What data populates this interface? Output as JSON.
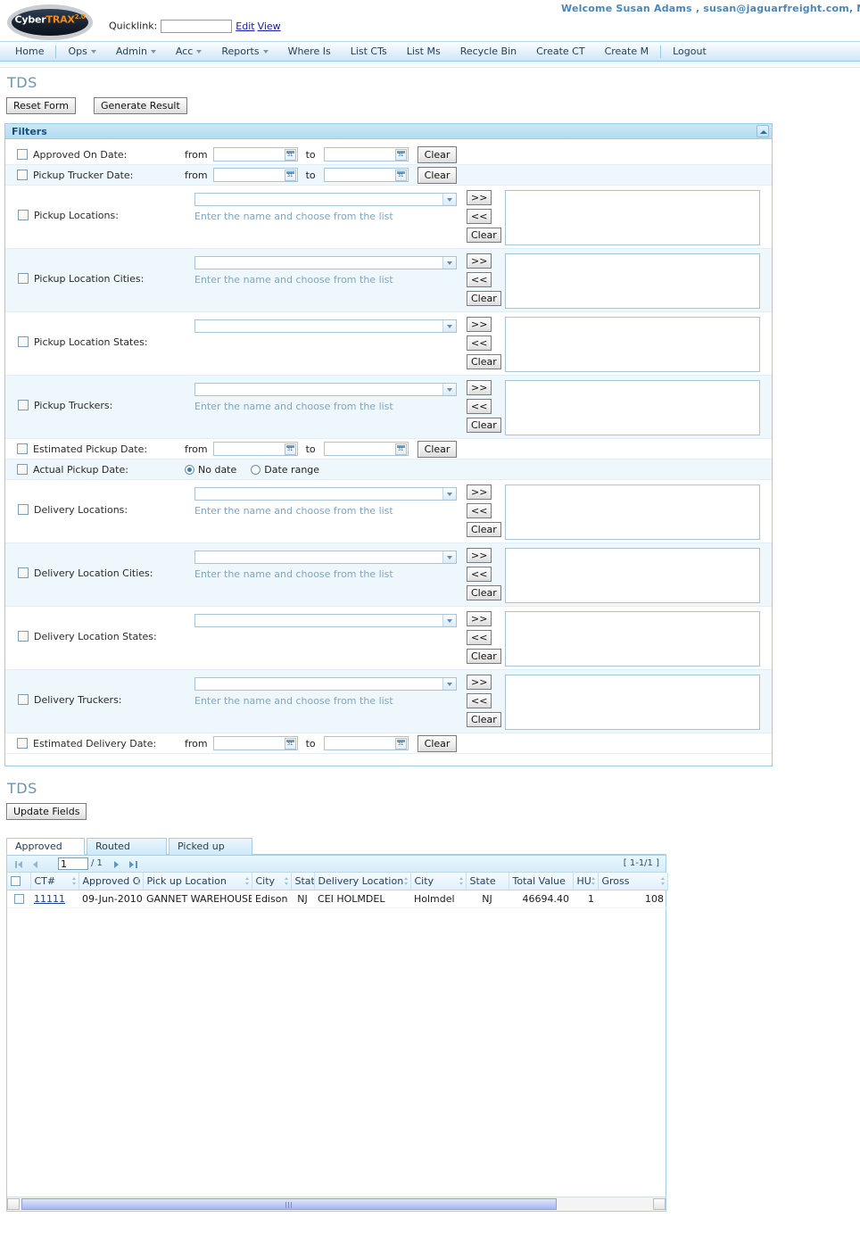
{
  "header": {
    "welcome": "Welcome  Susan Adams , susan@jaguarfreight.com, Ne",
    "logo_cyber": "Cyber",
    "logo_trax": "TRAX",
    "logo_version": "2.0",
    "quicklink_label": "Quicklink:",
    "quicklink_value": "",
    "quicklink_edit": "Edit",
    "quicklink_view": "View"
  },
  "nav": {
    "items": [
      {
        "label": "Home",
        "caret": false
      },
      {
        "label": "Ops",
        "caret": true
      },
      {
        "label": "Admin",
        "caret": true
      },
      {
        "label": "Acc",
        "caret": true
      },
      {
        "label": "Reports",
        "caret": true
      },
      {
        "label": "Where Is",
        "caret": false
      },
      {
        "label": "List CTs",
        "caret": false
      },
      {
        "label": "List Ms",
        "caret": false
      },
      {
        "label": "Recycle Bin",
        "caret": false
      },
      {
        "label": "Create CT",
        "caret": false
      },
      {
        "label": "Create M",
        "caret": false
      },
      {
        "label": "Logout",
        "caret": false
      }
    ]
  },
  "page": {
    "title_top": "TDS",
    "title_bottom": "TDS",
    "reset_button": "Reset Form",
    "generate_button": "Generate Result",
    "update_fields_button": "Update Fields"
  },
  "filters": {
    "panel_title": "Filters",
    "from_label": "from",
    "to_label": "to",
    "clear_label": "Clear",
    "add_label": ">>",
    "remove_label": "<<",
    "hint": "Enter the name and choose from the list",
    "rows": [
      {
        "label": "Approved On Date:",
        "type": "date",
        "from": "",
        "to": ""
      },
      {
        "label": "Pickup Trucker Date:",
        "type": "date",
        "from": "",
        "to": ""
      },
      {
        "label": "Pickup Locations:",
        "type": "pick",
        "hint": true,
        "value": "",
        "selected": ""
      },
      {
        "label": "Pickup Location Cities:",
        "type": "pick",
        "hint": true,
        "value": "",
        "selected": ""
      },
      {
        "label": "Pickup Location States:",
        "type": "pick",
        "hint": false,
        "value": "",
        "selected": ""
      },
      {
        "label": "Pickup Truckers:",
        "type": "pick",
        "hint": true,
        "value": "",
        "selected": ""
      },
      {
        "label": "Estimated Pickup Date:",
        "type": "date",
        "from": "",
        "to": ""
      },
      {
        "label": "Actual Pickup Date:",
        "type": "radio",
        "options": [
          "No date",
          "Date range"
        ],
        "selected": "No date"
      },
      {
        "label": "Delivery Locations:",
        "type": "pick",
        "hint": true,
        "value": "",
        "selected": ""
      },
      {
        "label": "Delivery Location Cities:",
        "type": "pick",
        "hint": true,
        "value": "",
        "selected": ""
      },
      {
        "label": "Delivery Location States:",
        "type": "pick",
        "hint": false,
        "value": "",
        "selected": ""
      },
      {
        "label": "Delivery Truckers:",
        "type": "pick",
        "hint": true,
        "value": "",
        "selected": ""
      },
      {
        "label": "Estimated Delivery Date:",
        "type": "date",
        "from": "",
        "to": ""
      }
    ]
  },
  "results": {
    "tabs": [
      {
        "label": "Approved",
        "active": true
      },
      {
        "label": "Routed",
        "active": false
      },
      {
        "label": "Picked up",
        "active": false
      }
    ],
    "paging": {
      "page_value": "1",
      "page_total": "/ 1",
      "range": "[ 1-1/1 ]"
    },
    "columns": [
      "CT#",
      "Approved O",
      "Pick up Location",
      "City",
      "Stat",
      "Delivery Location",
      "City",
      "State",
      "Total Value",
      "HU",
      "Gross "
    ],
    "rows": [
      {
        "ct": "11111",
        "approved_on": "09-Jun-2010",
        "pickup_location": "GANNET WAREHOUSE",
        "pickup_city": "Edison",
        "pickup_state": "NJ",
        "delivery_location": "CEI HOLMDEL",
        "delivery_city": "Holmdel",
        "delivery_state": "NJ",
        "total_value": "46694.40",
        "hu": "1",
        "gross": "108"
      }
    ]
  },
  "colors": {
    "accent": "#4a87b8",
    "panel_border": "#9ccbe4",
    "panel_header": "#b3dcf2",
    "link": "#1c3f8f",
    "logo_orange": "#f08a1e"
  }
}
